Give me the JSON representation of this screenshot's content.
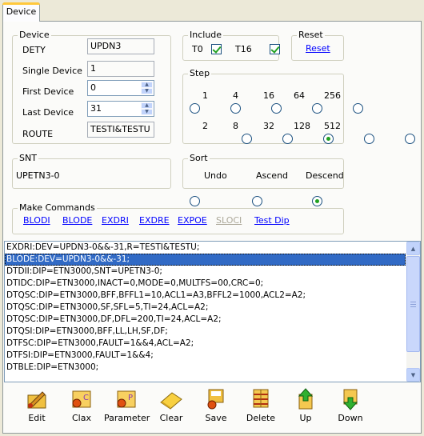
{
  "tab": {
    "label": "Device"
  },
  "device": {
    "title": "Device",
    "dety_label": "DETY",
    "dety_value": "UPDN3",
    "single_label": "Single Device",
    "single_value": "1",
    "first_label": "First Device",
    "first_value": "0",
    "last_label": "Last Device",
    "last_value": "31",
    "route_label": "ROUTE",
    "route_value": "TESTI&TESTU"
  },
  "include": {
    "title": "Include",
    "t0_label": "T0",
    "t16_label": "T16",
    "t0_checked": true,
    "t16_checked": true
  },
  "reset": {
    "title": "Reset",
    "link": "Reset"
  },
  "step": {
    "title": "Step",
    "options": [
      "1",
      "4",
      "16",
      "64",
      "256",
      "2",
      "8",
      "32",
      "128",
      "512"
    ],
    "selected": "32"
  },
  "snt": {
    "title": "SNT",
    "value": "UPETN3-0"
  },
  "sort": {
    "title": "Sort",
    "options": [
      "Undo",
      "Ascend",
      "Descend"
    ],
    "selected": "Descend"
  },
  "make_commands": {
    "title": "Make Commands",
    "links": [
      "BLODI",
      "BLODE",
      "EXDRI",
      "EXDRE",
      "EXPOE",
      "SLOCI",
      "Test Dip"
    ],
    "disabled": [
      "SLOCI"
    ]
  },
  "commands": {
    "selected_index": 1,
    "rows": [
      "EXDRI:DEV=UPDN3-0&&-31,R=TESTI&TESTU;",
      "BLODE:DEV=UPDN3-0&&-31;",
      "DTDII:DIP=ETN3000,SNT=UPETN3-0;",
      "DTIDC:DIP=ETN3000,INACT=0,MODE=0,MULTFS=00,CRC=0;",
      "DTQSC:DIP=ETN3000,BFF,BFFL1=10,ACL1=A3,BFFL2=1000,ACL2=A2;",
      "DTQSC:DIP=ETN3000,SF,SFL=5,TI=24,ACL=A2;",
      "DTQSC:DIP=ETN3000,DF,DFL=200,TI=24,ACL=A2;",
      "DTQSI:DIP=ETN3000,BFF,LL,LH,SF,DF;",
      "DTFSC:DIP=ETN3000,FAULT=1&&4,ACL=A2;",
      "DTFSI:DIP=ETN3000,FAULT=1&&4;",
      "DTBLE:DIP=ETN3000;"
    ]
  },
  "toolbar": {
    "edit": "Edit",
    "clax": "Clax",
    "parameter": "Parameter",
    "clear": "Clear",
    "save": "Save",
    "delete": "Delete",
    "up": "Up",
    "down": "Down"
  },
  "colors": {
    "selection": "#316ac5",
    "link": "#0000ff",
    "check": "#21a121"
  }
}
